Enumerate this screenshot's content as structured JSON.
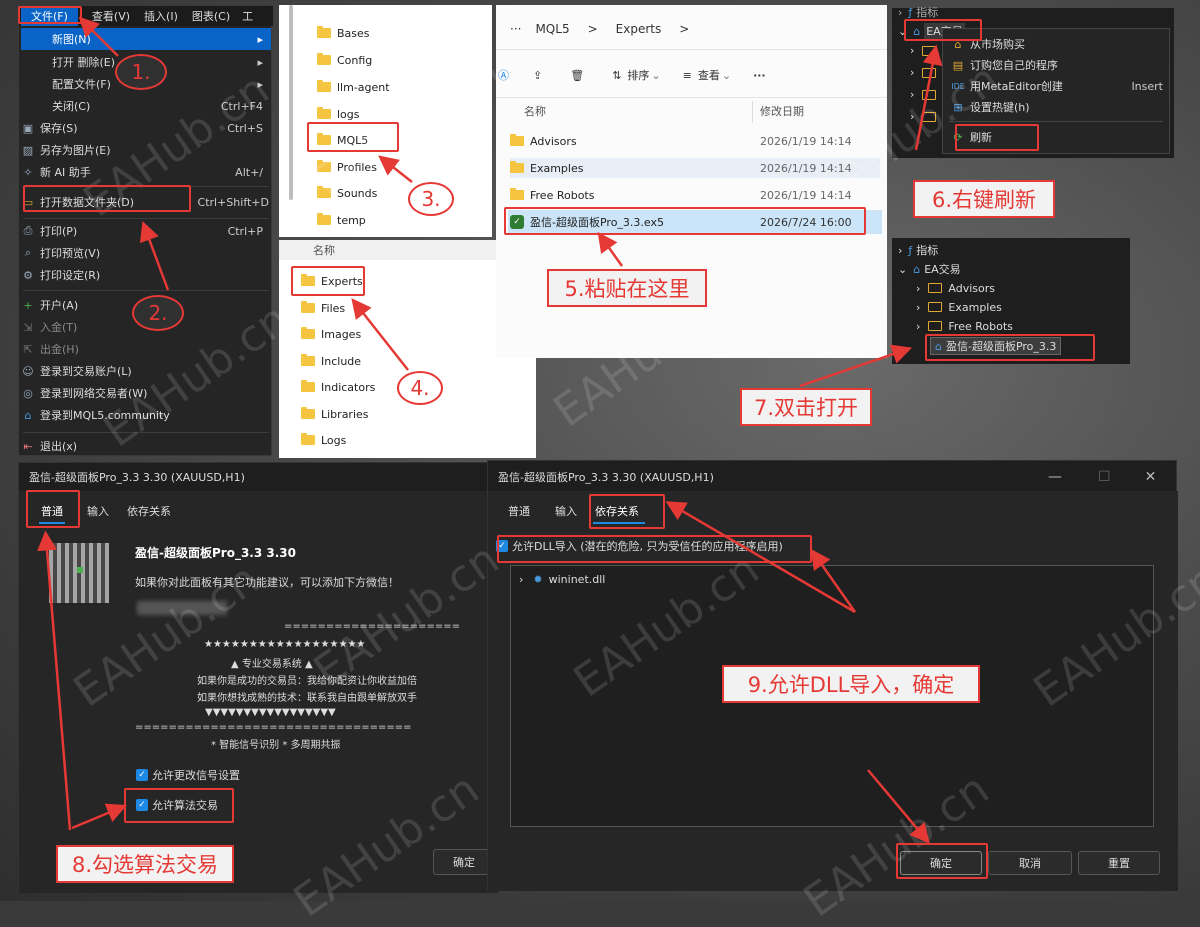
{
  "menubar": [
    "文件(F)",
    "查看(V)",
    "插入(I)",
    "图表(C)",
    "工"
  ],
  "file_menu": [
    {
      "label": "新图(N)",
      "shortcut": ""
    },
    {
      "label": "打开 删除(E)",
      "shortcut": ""
    },
    {
      "label": "配置文件(F)",
      "shortcut": ""
    },
    {
      "label": "关闭(C)",
      "shortcut": "Ctrl+F4"
    },
    {
      "label": "保存(S)",
      "shortcut": "Ctrl+S"
    },
    {
      "label": "另存为图片(E)",
      "shortcut": ""
    },
    {
      "label": "新 AI 助手",
      "shortcut": "Alt+/"
    },
    {
      "label": "打开数据文件夹(D)",
      "shortcut": "Ctrl+Shift+D"
    },
    {
      "label": "打印(P)",
      "shortcut": "Ctrl+P"
    },
    {
      "label": "打印预览(V)",
      "shortcut": ""
    },
    {
      "label": "打印设定(R)",
      "shortcut": ""
    },
    {
      "label": "开户(A)",
      "shortcut": ""
    },
    {
      "label": "入金(T)",
      "shortcut": ""
    },
    {
      "label": "出金(H)",
      "shortcut": ""
    },
    {
      "label": "登录到交易账户(L)",
      "shortcut": ""
    },
    {
      "label": "登录到网络交易者(W)",
      "shortcut": ""
    },
    {
      "label": "登录到MQL5.community",
      "shortcut": ""
    },
    {
      "label": "退出(x)",
      "shortcut": ""
    }
  ],
  "explorer1": {
    "items": [
      "Bases",
      "Config",
      "llm-agent",
      "logs",
      "MQL5",
      "Profiles",
      "Sounds",
      "temp"
    ]
  },
  "explorer2": {
    "header": "名称",
    "items": [
      "Experts",
      "Files",
      "Images",
      "Include",
      "Indicators",
      "Libraries",
      "Logs"
    ]
  },
  "explorer3": {
    "breadcrumb": [
      "···",
      "MQL5",
      ">",
      "Experts",
      ">"
    ],
    "toolbar": {
      "sort": "排序",
      "view": "查看",
      "more": "···"
    },
    "columns": [
      "名称",
      "修改日期"
    ],
    "rows": [
      {
        "name": "Advisors",
        "date": "2026/1/19 14:14"
      },
      {
        "name": "Examples",
        "date": "2026/1/19 14:14"
      },
      {
        "name": "Free Robots",
        "date": "2026/1/19 14:14"
      },
      {
        "name": "盈信-超级面板Pro_3.3.ex5",
        "date": "2026/7/24 16:00"
      }
    ]
  },
  "navigator_top": {
    "items": [
      "指标",
      "EA交易"
    ],
    "context": [
      {
        "label": "从市场购买",
        "shortcut": ""
      },
      {
        "label": "订购您自己的程序",
        "shortcut": ""
      },
      {
        "label": "用MetaEditor创建",
        "shortcut": "Insert"
      },
      {
        "label": "设置热键(h)",
        "shortcut": ""
      },
      {
        "label": "刷新",
        "shortcut": ""
      }
    ]
  },
  "navigator_bottom": {
    "items": [
      "指标",
      "EA交易",
      "Advisors",
      "Examples",
      "Free Robots",
      "盈信-超级面板Pro_3.3"
    ]
  },
  "dialog1": {
    "title": "盈信-超级面板Pro_3.3 3.30 (XAUUSD,H1)",
    "tabs": [
      "普通",
      "输入",
      "依存关系"
    ],
    "product": "盈信-超级面板Pro_3.3 3.30",
    "desc": "如果你对此面板有其它功能建议，可以添加下方微信！",
    "lines": [
      "=====================",
      "★★★★★★★★★★★★★★★★★★",
      "▲ 专业交易系统 ▲",
      "如果你是成功的交易员：我给你配资让你收益加倍",
      "如果你想找成熟的技术：联系我自由跟单解放双手",
      "▼▼▼▼▼▼▼▼▼▼▼▼▼▼▼▼▼",
      "=================================",
      "* 智能信号识别   * 多周期共振"
    ],
    "cb1": "允许更改信号设置",
    "cb2": "允许算法交易",
    "ok": "确定"
  },
  "dialog2": {
    "title": "盈信-超级面板Pro_3.3 3.30 (XAUUSD,H1)",
    "tabs": [
      "普通",
      "输入",
      "依存关系"
    ],
    "cb": "允许DLL导入 (潜在的危险, 只为受信任的应用程序启用)",
    "dll": "wininet.dll",
    "ok": "确定",
    "cancel": "取消",
    "reset": "重置"
  },
  "annotations": {
    "c1": "1.",
    "c2": "2.",
    "c3": "3.",
    "c4": "4.",
    "s5": "5.粘贴在这里",
    "s6": "6.右键刷新",
    "s7": "7.双击打开",
    "s8": "8.勾选算法交易",
    "s9": "9.允许DLL导入，确定"
  },
  "watermark": "EAHub.cn",
  "colors": {
    "accent": "#1e88e5",
    "annotation": "#e53935",
    "folder": "#f5c542"
  }
}
